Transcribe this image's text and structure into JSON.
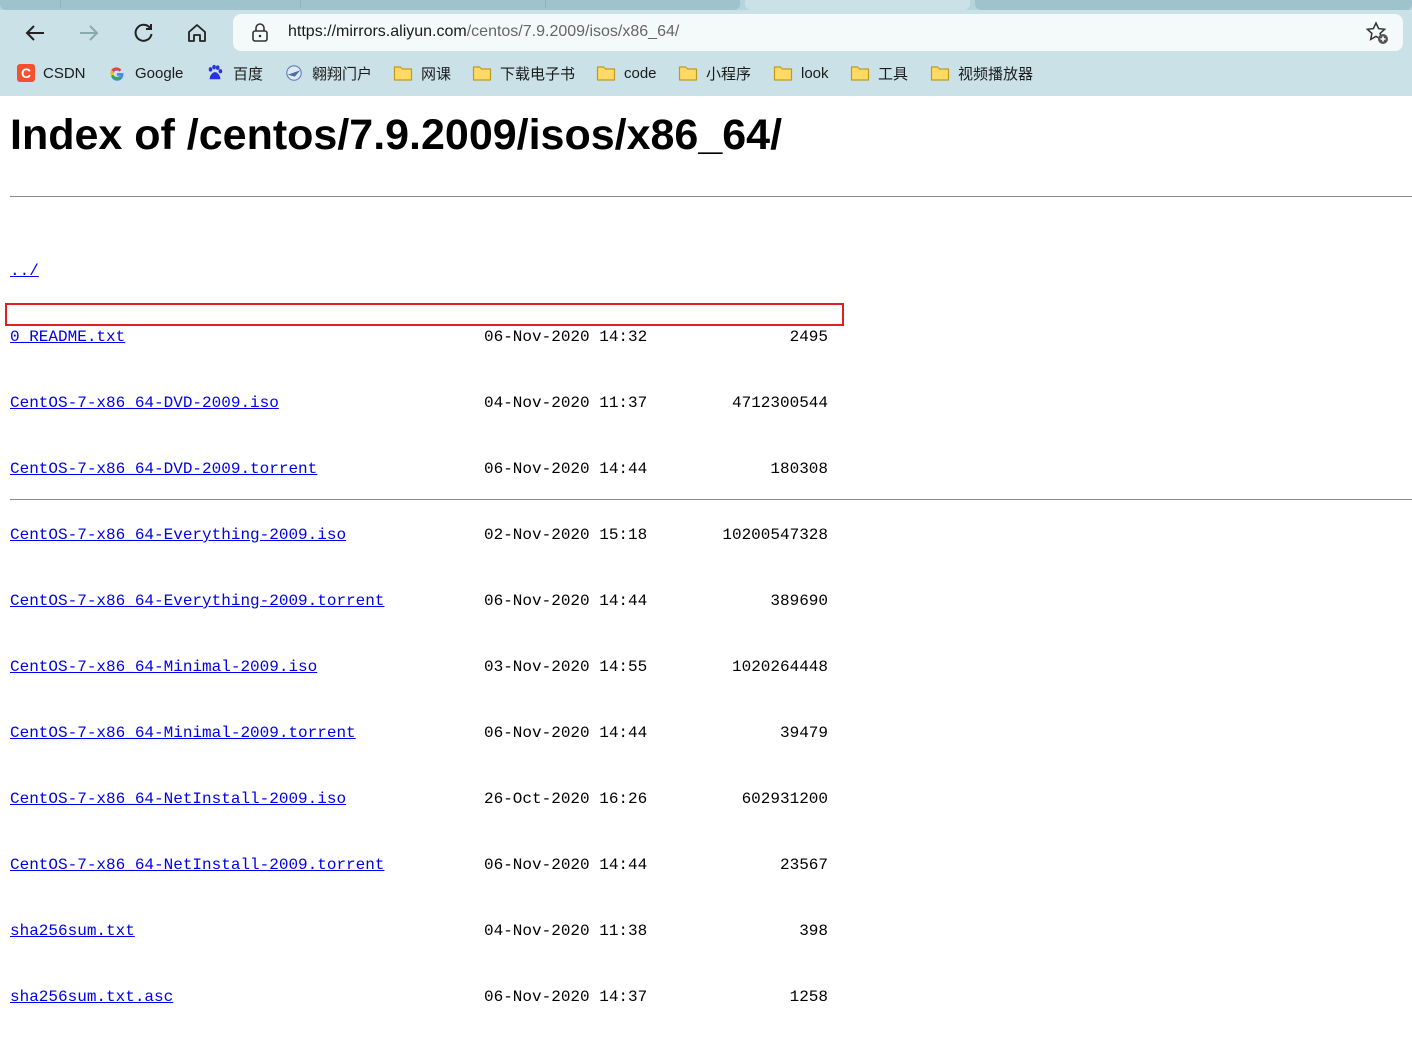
{
  "browser": {
    "address": {
      "host": "https://mirrors.aliyun.com",
      "path": "/centos/7.9.2009/isos/x86_64/"
    },
    "bookmarks": [
      {
        "label": "CSDN",
        "icon": "csdn-icon"
      },
      {
        "label": "Google",
        "icon": "google-icon"
      },
      {
        "label": "百度",
        "icon": "baidu-icon"
      },
      {
        "label": "翱翔门户",
        "icon": "portal-icon"
      },
      {
        "label": "网课",
        "icon": "folder-icon"
      },
      {
        "label": "下载电子书",
        "icon": "folder-icon"
      },
      {
        "label": "code",
        "icon": "folder-icon"
      },
      {
        "label": "小程序",
        "icon": "folder-icon"
      },
      {
        "label": "look",
        "icon": "folder-icon"
      },
      {
        "label": "工具",
        "icon": "folder-icon"
      },
      {
        "label": "视频播放器",
        "icon": "folder-icon"
      }
    ]
  },
  "page": {
    "title": "Index of /centos/7.9.2009/isos/x86_64/",
    "parent_link": "../",
    "files": [
      {
        "name": "0_README.txt",
        "date": "06-Nov-2020 14:32",
        "size": "2495"
      },
      {
        "name": "CentOS-7-x86_64-DVD-2009.iso",
        "date": "04-Nov-2020 11:37",
        "size": "4712300544"
      },
      {
        "name": "CentOS-7-x86_64-DVD-2009.torrent",
        "date": "06-Nov-2020 14:44",
        "size": "180308"
      },
      {
        "name": "CentOS-7-x86_64-Everything-2009.iso",
        "date": "02-Nov-2020 15:18",
        "size": "10200547328"
      },
      {
        "name": "CentOS-7-x86_64-Everything-2009.torrent",
        "date": "06-Nov-2020 14:44",
        "size": "389690"
      },
      {
        "name": "CentOS-7-x86_64-Minimal-2009.iso",
        "date": "03-Nov-2020 14:55",
        "size": "1020264448"
      },
      {
        "name": "CentOS-7-x86_64-Minimal-2009.torrent",
        "date": "06-Nov-2020 14:44",
        "size": "39479"
      },
      {
        "name": "CentOS-7-x86_64-NetInstall-2009.iso",
        "date": "26-Oct-2020 16:26",
        "size": "602931200"
      },
      {
        "name": "CentOS-7-x86_64-NetInstall-2009.torrent",
        "date": "06-Nov-2020 14:44",
        "size": "23567"
      },
      {
        "name": "sha256sum.txt",
        "date": "04-Nov-2020 11:38",
        "size": "398"
      },
      {
        "name": "sha256sum.txt.asc",
        "date": "06-Nov-2020 14:37",
        "size": "1258"
      }
    ]
  },
  "colors": {
    "link": "#0000ee",
    "highlight": "#e02020",
    "chrome": "#c9e1e7"
  }
}
